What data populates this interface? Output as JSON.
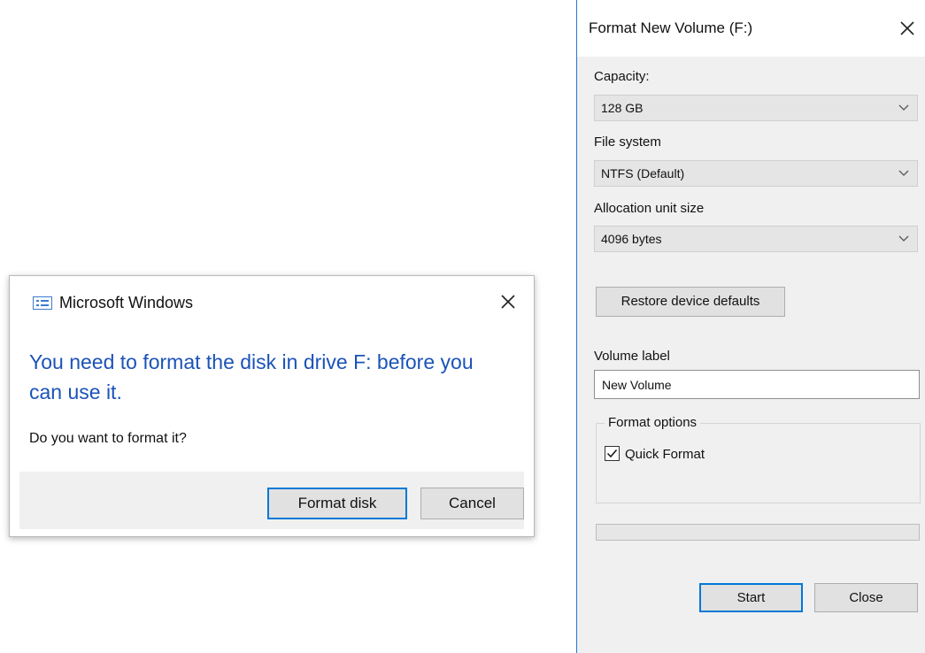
{
  "message_dialog": {
    "title": "Microsoft Windows",
    "instruction": "You need to format the disk in drive F: before you can use it.",
    "content": "Do you want to format it?",
    "buttons": {
      "primary": "Format disk",
      "secondary": "Cancel"
    },
    "icons": {
      "app": "window-list-icon",
      "close": "close-icon"
    }
  },
  "format_dialog": {
    "title": "Format New Volume (F:)",
    "capacity": {
      "label": "Capacity:",
      "value": "128 GB"
    },
    "file_system": {
      "label": "File system",
      "value": "NTFS (Default)"
    },
    "allocation_unit": {
      "label": "Allocation unit size",
      "value": "4096 bytes"
    },
    "restore_button": "Restore device defaults",
    "volume_label": {
      "label": "Volume label",
      "value": "New Volume"
    },
    "format_options": {
      "legend": "Format options",
      "quick_format": {
        "label": "Quick Format",
        "checked": true
      }
    },
    "progress": {
      "percent": 0
    },
    "buttons": {
      "start": "Start",
      "close": "Close"
    }
  },
  "colors": {
    "accent": "#0078d7",
    "instruction_text": "#1b53b8",
    "dialog_face": "#f0f0f0"
  }
}
